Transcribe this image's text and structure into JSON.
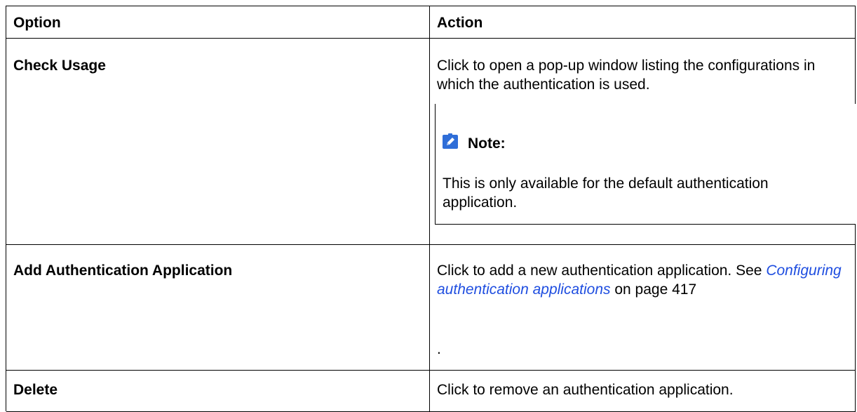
{
  "table": {
    "headers": {
      "option": "Option",
      "action": "Action"
    },
    "rows": [
      {
        "option": "Check Usage",
        "action": "Click to open a pop-up window listing the configurations in which the authentication is used.",
        "note": {
          "icon": "pencil-note-icon",
          "title": "Note:",
          "body": "This is only available for the default authentication application."
        }
      },
      {
        "option": "Add Authentication Application",
        "action_prefix": "Click to add a new authentication application. See ",
        "link_text": "Configuring authentication applications",
        "action_suffix": " on page 417",
        "trailing": "."
      },
      {
        "option": "Delete",
        "action": "Click to remove an authentication application."
      }
    ]
  },
  "colors": {
    "border": "#000000",
    "link": "#1f4ee0",
    "note_icon_bg": "#2f6ed8"
  }
}
